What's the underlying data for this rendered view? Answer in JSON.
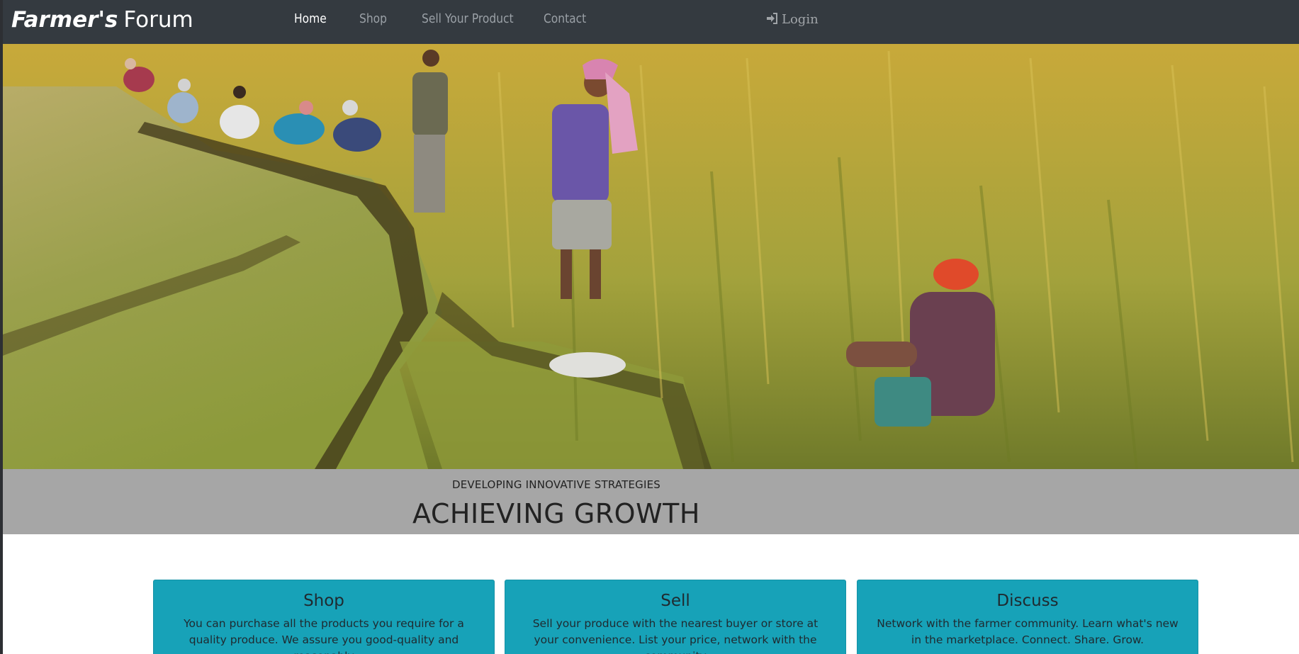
{
  "navbar": {
    "brand_italic": "Farmer's",
    "brand_rest": "Forum",
    "links": {
      "home": "Home",
      "shop": "Shop",
      "sell": "Sell Your Product",
      "contact": "Contact"
    },
    "login": "Login",
    "login_icon": "sign-in-icon"
  },
  "hero": {
    "image_subject": "farmers harvesting a golden rice field"
  },
  "caption": {
    "small": "DEVELOPING INNOVATIVE STRATEGIES",
    "big": "ACHIEVING GROWTH"
  },
  "cards": [
    {
      "title": "Shop",
      "text": "You can purchase all the products you require for a quality produce. We assure you good-quality and reasonably"
    },
    {
      "title": "Sell",
      "text": "Sell your produce with the nearest buyer or store at your convenience. List your price, network with the community"
    },
    {
      "title": "Discuss",
      "text": "Network with the farmer community. Learn what's new in the marketplace. Connect. Share. Grow."
    }
  ],
  "colors": {
    "navbar_bg": "#343a40",
    "caption_band_bg": "#a6a6a6",
    "card_bg": "#17a2b8",
    "active_link": "#ffffff",
    "inactive_link": "#9aa0a6"
  }
}
